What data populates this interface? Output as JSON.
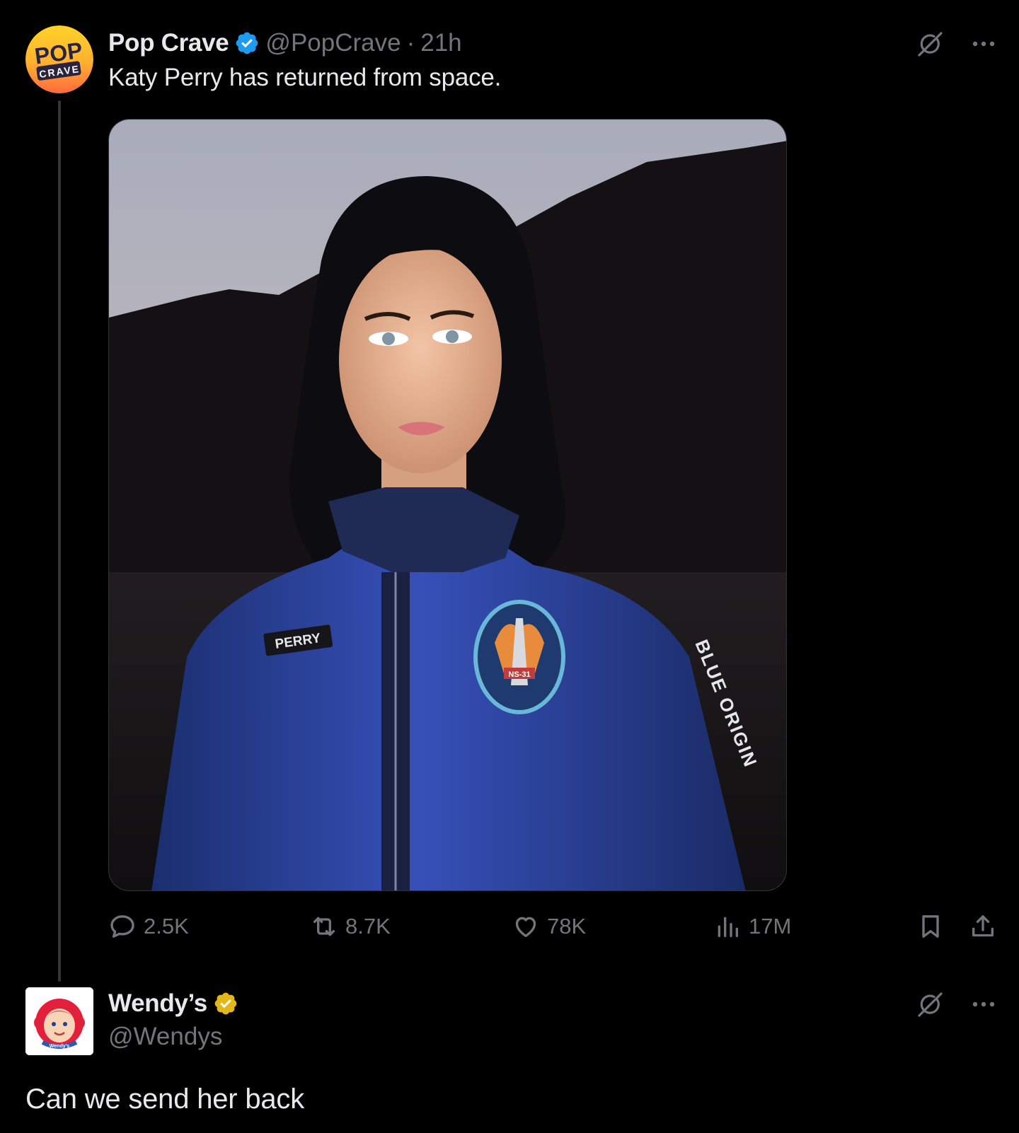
{
  "post": {
    "author": {
      "name": "Pop Crave",
      "handle": "@PopCrave",
      "time": "21h",
      "separator": "·",
      "verified": "blue"
    },
    "avatar_logo": {
      "top": "POP",
      "bottom": "CRAVE"
    },
    "text": "Katy Perry has returned from space.",
    "media": {
      "patch_label": "PERRY",
      "sleeve_text": "BLUE ORIGIN",
      "badge_text": "NS-31"
    },
    "stats": {
      "replies": "2.5K",
      "reposts": "8.7K",
      "likes": "78K",
      "views": "17M"
    }
  },
  "reply": {
    "author": {
      "name": "Wendy’s",
      "handle": "@Wendys",
      "verified": "gold"
    },
    "avatar_logo": "Wendy's",
    "text": "Can we send her back"
  },
  "colors": {
    "background": "#000000",
    "text": "#e7e9ea",
    "muted": "#71767b",
    "verified_blue": "#1d9bf0",
    "verified_gold": "#e2b719"
  },
  "icons": [
    "grok-icon",
    "more-icon",
    "reply-icon",
    "repost-icon",
    "like-icon",
    "views-icon",
    "bookmark-icon",
    "share-icon",
    "verified-badge-icon"
  ]
}
